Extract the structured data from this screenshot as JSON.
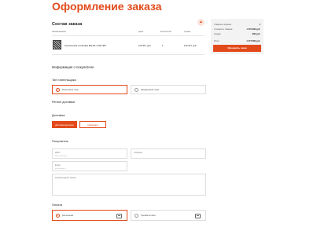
{
  "page": {
    "title": "Оформление заказа"
  },
  "order": {
    "heading": "Состав заказа",
    "collapse_icon": "chevron-up-icon",
    "columns": [
      "Наименование",
      "Цена",
      "Количество",
      "Сумма"
    ],
    "items": [
      {
        "name": "Техническая установка ВЦ-4Ф 1 000 484",
        "price": "120 917 руб.",
        "qty": "1",
        "sum": "120 917 руб."
      }
    ]
  },
  "summary": {
    "rows": [
      {
        "label": "Товаров в корзине",
        "value": "1"
      },
      {
        "label": "Стоимость товаров",
        "value": "1 070 982 руб."
      },
      {
        "label": "Скидка",
        "value": "960 руб."
      },
      {
        "label": "Итого",
        "value": "1 077 882 руб."
      }
    ],
    "order_button": "Оформить заказ"
  },
  "buyer": {
    "heading": "Информация о покупателе",
    "payer_type_label": "Тип плательщика",
    "payer_types": [
      {
        "label": "Физическое лицо",
        "active": true
      },
      {
        "label": "Юридическое лицо",
        "active": false
      }
    ],
    "region_label": "Регион доставки"
  },
  "delivery": {
    "heading": "Доставка",
    "options": [
      {
        "label": "Доставка курьером",
        "active": true
      },
      {
        "label": "Самовывоз",
        "active": false
      }
    ]
  },
  "recipient": {
    "heading": "Получатель",
    "fields": {
      "name": {
        "label": "ФИО",
        "hint": "Иван Иванович"
      },
      "phone": {
        "label": "Телефон",
        "hint": ""
      },
      "email": {
        "label": "Email",
        "hint": "test@gmail.ru"
      },
      "comment": {
        "label": "Комментарий к заказу",
        "hint": ""
      }
    }
  },
  "payment": {
    "heading": "Оплата",
    "options": [
      {
        "label": "Наличными",
        "active": true,
        "icon": "cash-icon"
      },
      {
        "label": "Онлайн-оплата",
        "active": false,
        "icon": "card-icon"
      }
    ]
  },
  "colors": {
    "accent": "#e24a1a",
    "summary_bg": "#f3f3f3"
  }
}
